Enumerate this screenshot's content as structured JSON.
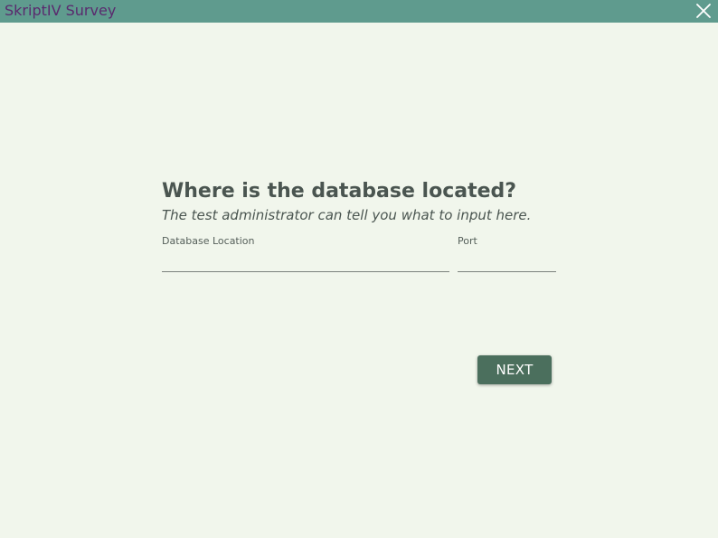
{
  "window": {
    "title": "SkriptIV Survey",
    "close_icon": "close-icon"
  },
  "question": {
    "heading": "Where is the database located?",
    "subheading": "The test administrator can tell you what to input here."
  },
  "fields": {
    "database_location": {
      "label": "Database Location",
      "value": "",
      "placeholder": ""
    },
    "port": {
      "label": "Port",
      "value": "",
      "placeholder": ""
    }
  },
  "actions": {
    "next_label": "NEXT"
  },
  "colors": {
    "titlebar": "#5f9b8e",
    "title_text": "#5a2a6e",
    "background": "#f1f6ec",
    "primary_button": "#4b6f5d",
    "heading_text": "#4a5550"
  }
}
